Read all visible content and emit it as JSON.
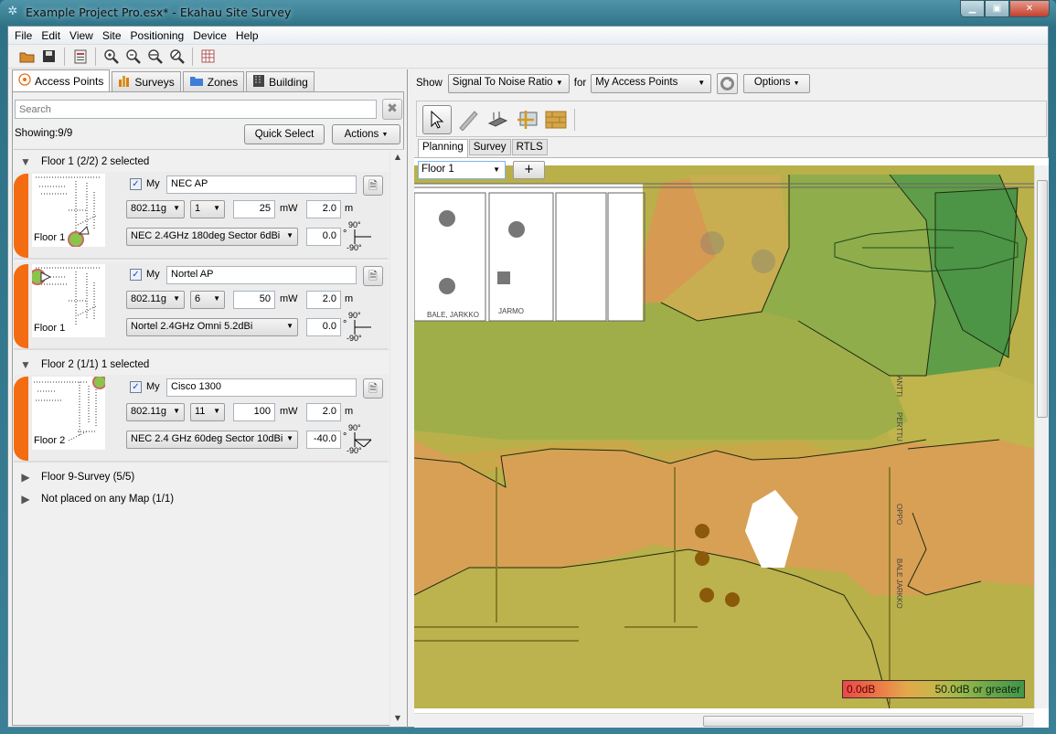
{
  "window": {
    "title": "Example Project Pro.esx* - Ekahau Site Survey",
    "controls": [
      "minimize",
      "maximize",
      "close"
    ]
  },
  "menubar": {
    "items": [
      {
        "label": "File",
        "mnemonic": "F"
      },
      {
        "label": "Edit",
        "mnemonic": "E"
      },
      {
        "label": "View",
        "mnemonic": "V"
      },
      {
        "label": "Site",
        "mnemonic": ""
      },
      {
        "label": "Positioning",
        "mnemonic": ""
      },
      {
        "label": "Device",
        "mnemonic": ""
      },
      {
        "label": "Help",
        "mnemonic": "H"
      }
    ]
  },
  "toolbar": {
    "icons": [
      "open-folder-icon",
      "save-icon",
      "report-icon",
      "zoom-in-icon",
      "zoom-out-icon",
      "zoom-fit-icon",
      "zoom-reset-icon",
      "table-icon"
    ]
  },
  "left_panel": {
    "tabs": [
      {
        "label": "Access Points",
        "icon": "access-point-icon",
        "active": true
      },
      {
        "label": "Surveys",
        "icon": "bar-chart-icon",
        "active": false
      },
      {
        "label": "Zones",
        "icon": "zones-icon",
        "active": false
      },
      {
        "label": "Building",
        "icon": "building-icon",
        "active": false
      }
    ],
    "search_placeholder": "Search",
    "showing": "Showing:9/9",
    "quick_select": "Quick Select",
    "actions": "Actions",
    "groups": [
      {
        "label": "Floor 1 (2/2) 2 selected",
        "expanded": true
      },
      {
        "label": "Floor 2 (1/1) 1 selected",
        "expanded": true
      },
      {
        "label": "Floor 9-Survey (5/5)",
        "expanded": false
      },
      {
        "label": "Not placed on any Map (1/1)",
        "expanded": false
      }
    ],
    "access_points": [
      {
        "floor": "Floor 1",
        "my_checked": true,
        "my_label": "My",
        "name": "NEC AP",
        "standard": "802.11g",
        "channel": "1",
        "power": "25",
        "power_unit": "mW",
        "height": "2.0",
        "height_unit": "m",
        "antenna": "NEC 2.4GHz 180deg Sector 6dBi",
        "tilt": "0.0",
        "tilt_unit": "°",
        "tilt_max": "90°",
        "tilt_min": "-90°"
      },
      {
        "floor": "Floor 1",
        "my_checked": true,
        "my_label": "My",
        "name": "Nortel AP",
        "standard": "802.11g",
        "channel": "6",
        "power": "50",
        "power_unit": "mW",
        "height": "2.0",
        "height_unit": "m",
        "antenna": "Nortel 2.4GHz Omni 5.2dBi",
        "tilt": "0.0",
        "tilt_unit": "°",
        "tilt_max": "90°",
        "tilt_min": "-90°"
      },
      {
        "floor": "Floor 2",
        "my_checked": true,
        "my_label": "My",
        "name": "Cisco 1300",
        "standard": "802.11g",
        "channel": "11",
        "power": "100",
        "power_unit": "mW",
        "height": "2.0",
        "height_unit": "m",
        "antenna": "NEC 2.4 GHz 60deg Sector 10dBi",
        "tilt": "-40.0",
        "tilt_unit": "°",
        "tilt_max": "90°",
        "tilt_min": "-90°"
      }
    ],
    "accent_color": "#f36c12"
  },
  "right_panel": {
    "show_label": "Show",
    "show_value": "Signal To Noise Ratio",
    "for_label": "for",
    "for_value": "My Access Points",
    "options": "Options",
    "tools": [
      "select-pointer-icon",
      "measure-ruler-icon",
      "access-point-tool-icon",
      "map-scale-icon",
      "wall-tool-icon"
    ],
    "mode_tabs": [
      {
        "label": "Planning",
        "active": true
      },
      {
        "label": "Survey",
        "active": false
      },
      {
        "label": "RTLS",
        "active": false
      }
    ],
    "floor": "Floor 1",
    "add_label": "+",
    "map_labels": [
      "BALE, JARKKO",
      "JARMO",
      "ANTTI",
      "PERTTU",
      "OPPO",
      "BALE JARKKO"
    ],
    "legend": {
      "min": "0.0dB",
      "max": "50.0dB or greater",
      "min_color": "#ec4848",
      "max_color": "#3f9648"
    }
  }
}
